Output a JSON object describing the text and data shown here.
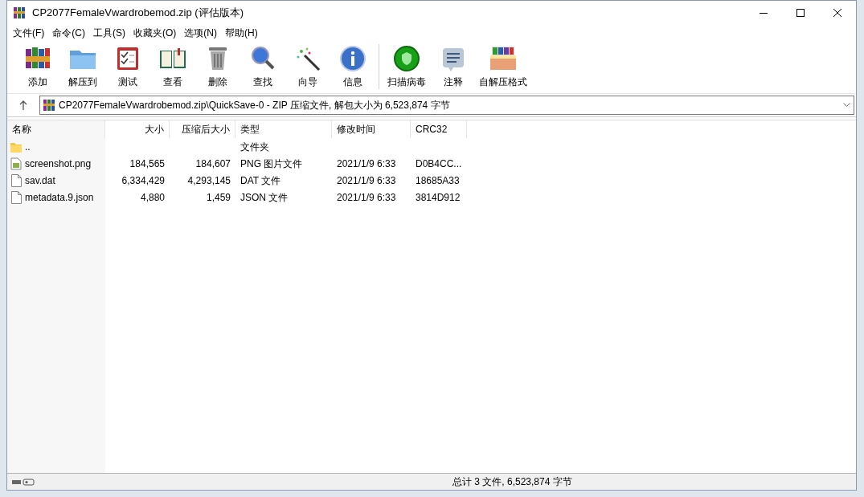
{
  "window": {
    "title": "CP2077FemaleVwardrobemod.zip (评估版本)"
  },
  "menu": [
    "文件(F)",
    "命令(C)",
    "工具(S)",
    "收藏夹(O)",
    "选项(N)",
    "帮助(H)"
  ],
  "toolbar": [
    {
      "label": "添加"
    },
    {
      "label": "解压到"
    },
    {
      "label": "测试"
    },
    {
      "label": "查看"
    },
    {
      "label": "删除"
    },
    {
      "label": "查找"
    },
    {
      "label": "向导"
    },
    {
      "label": "信息"
    },
    {
      "label": "扫描病毒"
    },
    {
      "label": "注释"
    },
    {
      "label": "自解压格式"
    }
  ],
  "address": {
    "value": "CP2077FemaleVwardrobemod.zip\\QuickSave-0 - ZIP 压缩文件, 解包大小为 6,523,874 字节"
  },
  "table": {
    "columns": [
      "名称",
      "大小",
      "压缩后大小",
      "类型",
      "修改时间",
      "CRC32"
    ],
    "rows": [
      {
        "kind": "folder",
        "cells": [
          "..",
          "",
          "",
          "文件夹",
          "",
          ""
        ]
      },
      {
        "kind": "image",
        "cells": [
          "screenshot.png",
          "184,565",
          "184,607",
          "PNG 图片文件",
          "2021/1/9 6:33",
          "D0B4CC..."
        ]
      },
      {
        "kind": "file",
        "cells": [
          "sav.dat",
          "6,334,429",
          "4,293,145",
          "DAT 文件",
          "2021/1/9 6:33",
          "18685A33"
        ]
      },
      {
        "kind": "file",
        "cells": [
          "metadata.9.json",
          "4,880",
          "1,459",
          "JSON 文件",
          "2021/1/9 6:33",
          "3814D912"
        ]
      }
    ]
  },
  "status_bar": {
    "text": "总计 3 文件, 6,523,874 字节"
  }
}
